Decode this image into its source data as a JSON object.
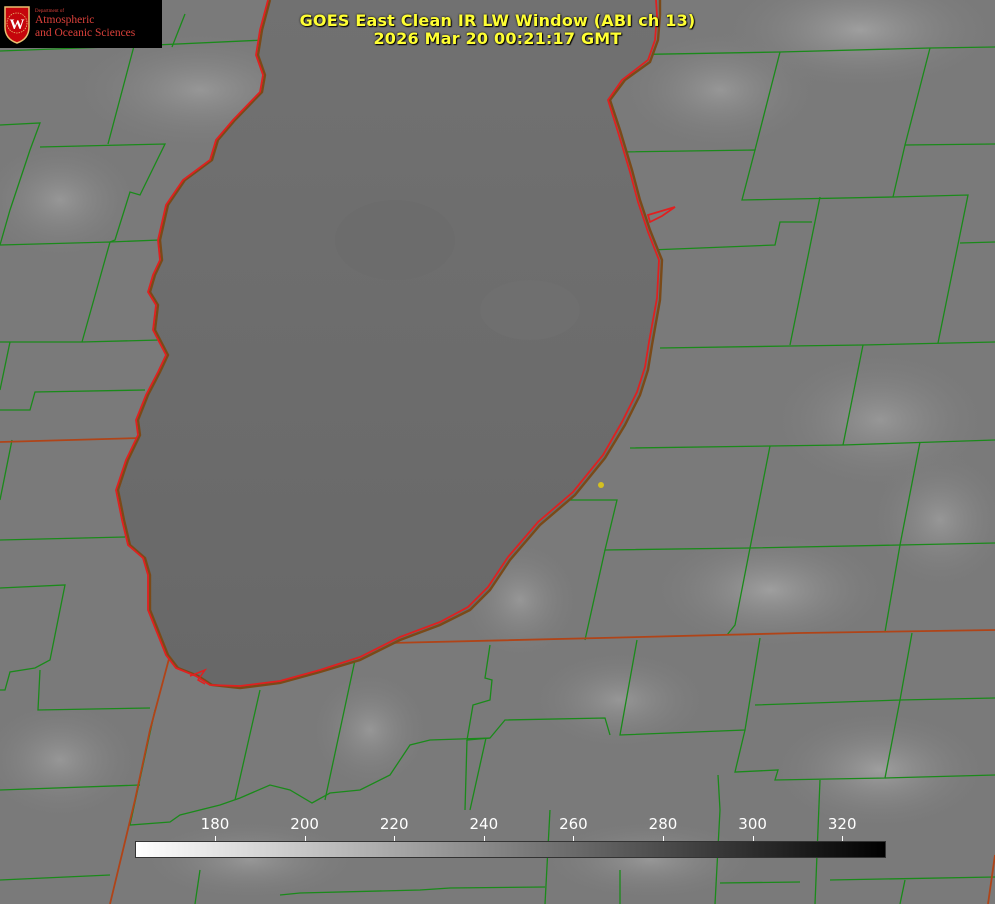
{
  "title": {
    "line1": "GOES East Clean IR LW Window (ABI ch 13)",
    "line2": "2026 Mar 20 00:21:17 GMT"
  },
  "logo": {
    "department": "Department of",
    "line1": "Atmospheric",
    "line2": "and Oceanic Sciences",
    "seal_letter": "W"
  },
  "colorbar": {
    "ticks": [
      "180",
      "200",
      "220",
      "240",
      "260",
      "280",
      "300",
      "320"
    ],
    "gradient_start": "#ffffff",
    "gradient_end": "#000000"
  },
  "map": {
    "lake_color": "#6a6a6a",
    "land_color": "#7c7c7c",
    "county_line_color": "#1a8a1a",
    "coast_line_color": "#e02020",
    "state_line_color": "#b04418",
    "marker_color": "#d4c020"
  }
}
